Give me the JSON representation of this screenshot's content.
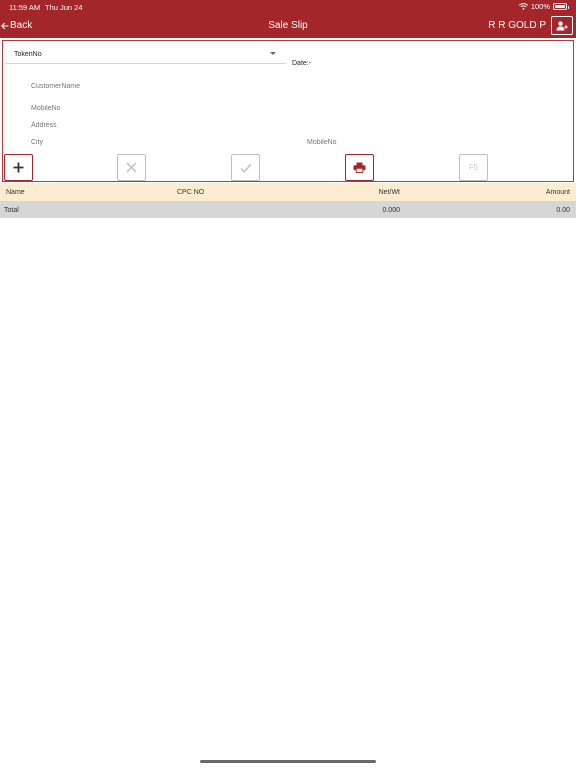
{
  "status_bar": {
    "time": "11:59 AM",
    "date": "Thu Jun 24",
    "battery": "100%",
    "wifi_icon": "wifi-icon",
    "battery_icon": "battery-icon"
  },
  "nav": {
    "back_label": "Back",
    "back_icon": "arrow-left-icon",
    "title": "Sale Slip",
    "brand": "R R GOLD P",
    "user_icon": "user-add-icon"
  },
  "form": {
    "token_label": "TokenNo",
    "date_label": "Date:-",
    "customer_placeholder": "CustomerName",
    "mobile_placeholder": "MobileNo",
    "address_placeholder": "Address",
    "city_placeholder": "City",
    "mobile2_placeholder": "MobileNo"
  },
  "actions": {
    "add_icon": "plus-icon",
    "cancel_icon": "close-icon",
    "ok_icon": "check-icon",
    "print_icon": "printer-icon",
    "f5_label": "F5"
  },
  "table": {
    "headers": [
      "Name",
      "CPC NO",
      "Net/Wt",
      "Amount"
    ],
    "footer": {
      "label": "Total",
      "net_wt": "0.000",
      "amount": "0.00"
    }
  },
  "colors": {
    "primary": "#a3262a",
    "header_row": "#fdecd0",
    "total_row": "#d6d6d6"
  }
}
